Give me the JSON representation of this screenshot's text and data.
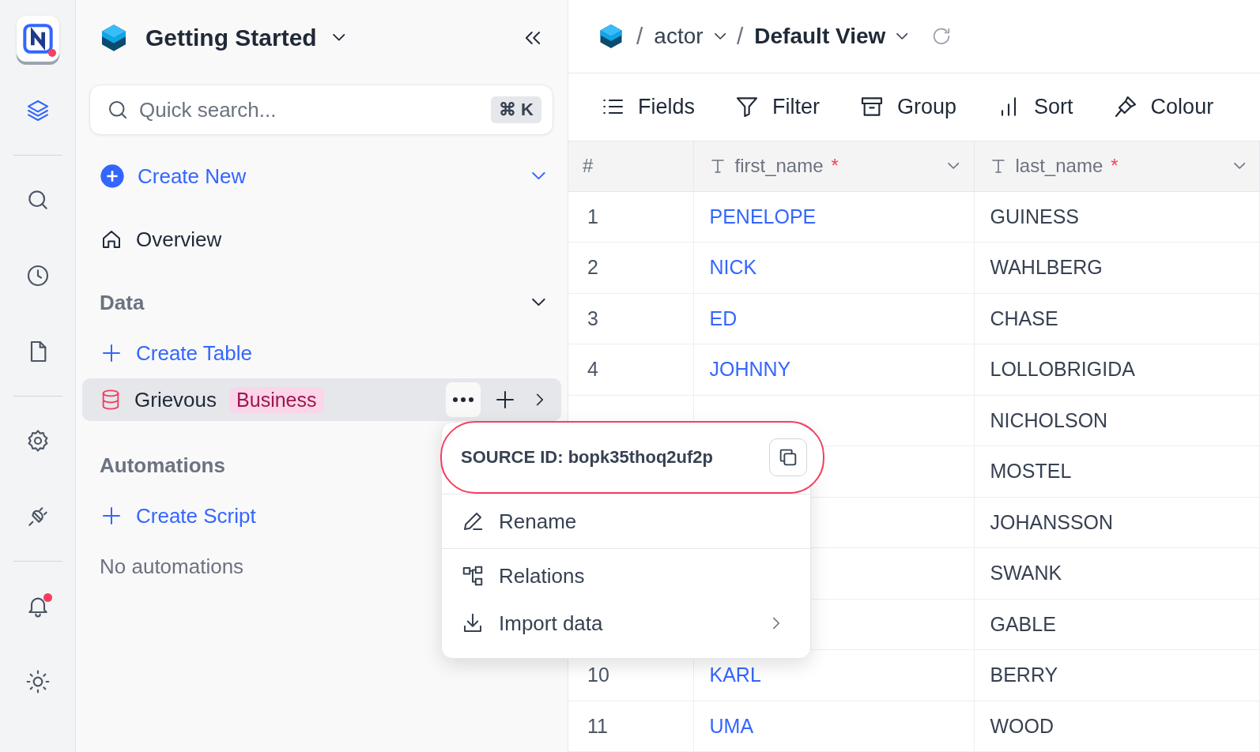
{
  "rail": {
    "logo": {
      "unread": true
    },
    "groups": [
      [
        {
          "kind": "layers",
          "selected": true
        }
      ],
      [
        {
          "kind": "search",
          "selected": false
        },
        {
          "kind": "clock",
          "selected": false
        },
        {
          "kind": "file",
          "selected": false
        }
      ],
      [
        {
          "kind": "gear",
          "selected": false
        },
        {
          "kind": "plug",
          "selected": false
        }
      ],
      [
        {
          "kind": "bell",
          "selected": false,
          "unread": true
        },
        {
          "kind": "sun",
          "selected": false
        }
      ]
    ]
  },
  "sidebar": {
    "workspace": "Getting Started",
    "search": {
      "placeholder": "Quick search...",
      "shortcut": "⌘ K"
    },
    "create_new": "Create New",
    "overview": "Overview",
    "data": {
      "title": "Data",
      "expanded": true,
      "create": "Create Table",
      "sources": [
        {
          "name": "Grievous",
          "badge": "Business",
          "selected": true
        }
      ]
    },
    "automations": {
      "title": "Automations",
      "create": "Create Script",
      "empty": "No automations"
    }
  },
  "breadcrumb": [
    {
      "kind": "table",
      "separator": "/",
      "label": "actor"
    },
    {
      "kind": "view",
      "separator": "/",
      "label": "Default View"
    }
  ],
  "toolbar": [
    {
      "kind": "fields",
      "label": "Fields"
    },
    {
      "kind": "filter",
      "label": "Filter"
    },
    {
      "kind": "group",
      "label": "Group"
    },
    {
      "kind": "sort",
      "label": "Sort"
    },
    {
      "kind": "colour",
      "label": "Colour"
    }
  ],
  "table": {
    "columns": [
      {
        "label": "#",
        "kind": "index"
      },
      {
        "label": "first_name",
        "kind": "text",
        "required_mark": "*"
      },
      {
        "label": "last_name",
        "kind": "text",
        "required_mark": "*"
      }
    ],
    "rows": [
      {
        "index": "1",
        "first_name": "PENELOPE",
        "last_name": "GUINESS"
      },
      {
        "index": "2",
        "first_name": "NICK",
        "last_name": "WAHLBERG"
      },
      {
        "index": "3",
        "first_name": "ED",
        "last_name": "CHASE"
      },
      {
        "index": "4",
        "first_name": "JOHNNY",
        "last_name": "LOLLOBRIGIDA"
      },
      {
        "last_name": "NICHOLSON"
      },
      {
        "last_name": "MOSTEL"
      },
      {
        "last_name": "JOHANSSON"
      },
      {
        "last_name": "SWANK"
      },
      {
        "last_name": "GABLE"
      },
      {
        "index": "10",
        "first_name": "KARL",
        "last_name": "BERRY"
      },
      {
        "index": "11",
        "first_name": "UMA",
        "last_name": "WOOD"
      }
    ]
  },
  "menu": {
    "source_id": "SOURCE ID: bopk35thoq2uf2p",
    "groups": [
      [
        {
          "kind": "rename",
          "label": "Rename"
        }
      ],
      [
        {
          "kind": "relations",
          "label": "Relations"
        },
        {
          "kind": "import",
          "label": "Import data",
          "submenu": true
        }
      ]
    ]
  }
}
